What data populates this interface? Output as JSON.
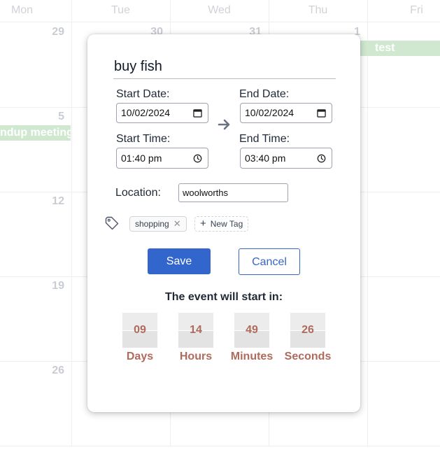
{
  "calendar": {
    "day_names": [
      "Mon",
      "Tue",
      "Wed",
      "Thu",
      "Fri"
    ],
    "dates": {
      "r1": [
        "29",
        "30",
        "31",
        "1"
      ],
      "r2": "5",
      "r3": "12",
      "r4": "19",
      "r5": "26"
    },
    "events": {
      "test": "test",
      "standup": "ndup meeting"
    },
    "event_color": "#cfe8cf"
  },
  "modal": {
    "title_value": "buy fish",
    "start_date_label": "Start Date:",
    "start_date_value": "10/02/2024",
    "end_date_label": "End Date:",
    "end_date_value": "10/02/2024",
    "start_time_label": "Start Time:",
    "start_time_value": "01:40 pm",
    "end_time_label": "End Time:",
    "end_time_value": "03:40 pm",
    "location_label": "Location:",
    "location_value": "woolworths",
    "tags": [
      "shopping"
    ],
    "new_tag_label": "New Tag",
    "save_label": "Save",
    "cancel_label": "Cancel",
    "countdown_heading": "The event will start in:",
    "countdown": {
      "days": "09",
      "days_label": "Days",
      "hours": "14",
      "hours_label": "Hours",
      "minutes": "49",
      "minutes_label": "Minutes",
      "seconds": "26",
      "seconds_label": "Seconds"
    },
    "accent_color": "#3366cc",
    "countdown_color": "#b06a5c"
  }
}
